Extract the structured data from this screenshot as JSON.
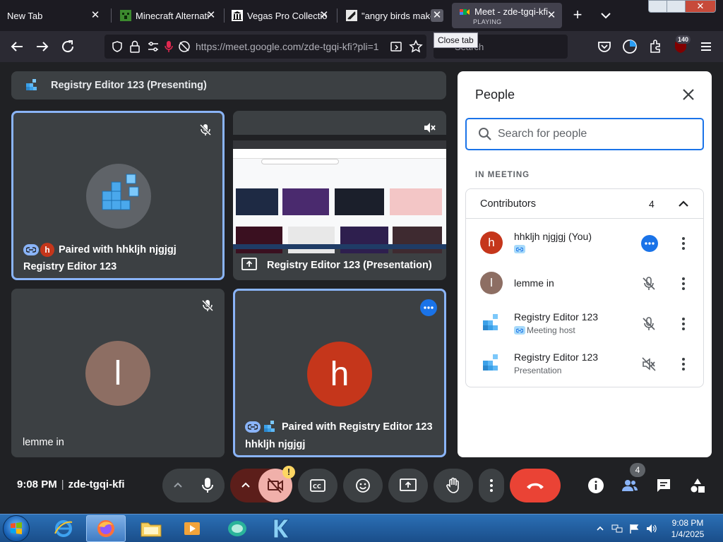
{
  "browser": {
    "tabs": [
      {
        "title": "New Tab"
      },
      {
        "title": "Minecraft Alternati"
      },
      {
        "title": "Vegas Pro Collectio"
      },
      {
        "title": "\"angry birds make"
      },
      {
        "title": "Meet - zde-tgqi-kfi",
        "sub": "PLAYING"
      }
    ],
    "tooltip": "Close tab",
    "url": "https://meet.google.com/zde-tgqi-kfi?pli=1",
    "search_placeholder": "Search",
    "notification_badge": "140"
  },
  "meet": {
    "presenting_banner": "Registry Editor 123 (Presenting)",
    "tiles": {
      "registry": {
        "paired_text": "Paired with hhkljh njgjgj",
        "paired_initial": "h",
        "name": "Registry Editor 123"
      },
      "presentation": {
        "name": "Registry Editor 123 (Presentation)"
      },
      "lemme": {
        "initial": "l",
        "name": "lemme in"
      },
      "self": {
        "initial": "h",
        "paired_text": "Paired with Registry Editor 123",
        "name": "hhkljh njgjgj"
      }
    },
    "colors": {
      "accent": "#8ab4f8",
      "avatar_h": "#c5361b",
      "avatar_l": "#8d6e63",
      "end_call": "#ea4335"
    }
  },
  "people_panel": {
    "title": "People",
    "search_placeholder": "Search for people",
    "section_label": "IN MEETING",
    "group_label": "Contributors",
    "group_count": "4",
    "people": [
      {
        "initial": "h",
        "name": "hhkljh njgjgj (You)",
        "sub": "",
        "status": "more-options-icon"
      },
      {
        "initial": "l",
        "name": "lemme in",
        "sub": "",
        "status": "mic-off-icon"
      },
      {
        "initial": "",
        "name": "Registry Editor 123",
        "sub": "Meeting host",
        "status": "mic-off-icon"
      },
      {
        "initial": "",
        "name": "Registry Editor 123",
        "sub": "Presentation",
        "status": "volume-off-icon"
      }
    ]
  },
  "controls": {
    "time": "9:08 PM",
    "meeting_code": "zde-tgqi-kfi",
    "cam_warning": "!",
    "people_count": "4"
  },
  "taskbar": {
    "time": "9:08 PM",
    "date": "1/4/2025"
  }
}
